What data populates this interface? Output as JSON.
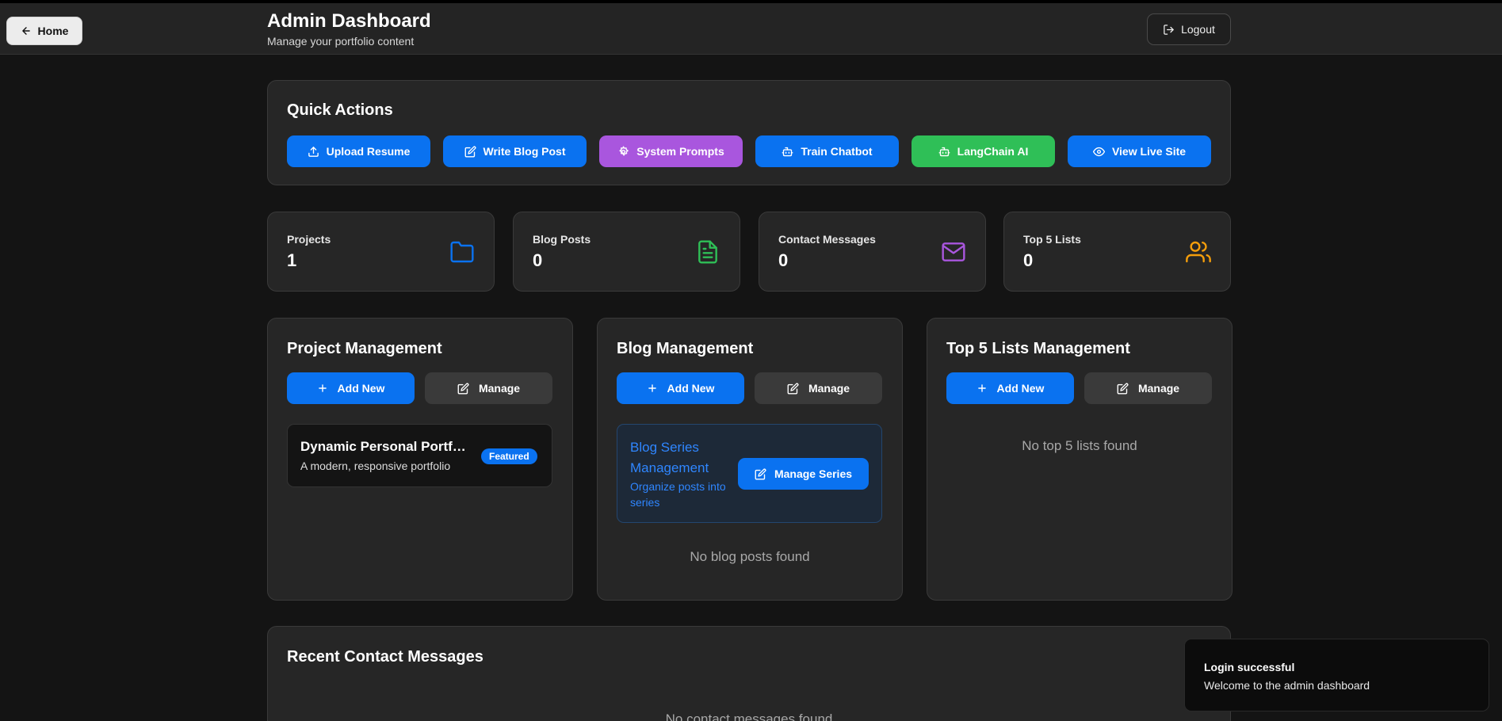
{
  "header": {
    "home_label": "Home",
    "title": "Admin Dashboard",
    "subtitle": "Manage your portfolio content",
    "logout_label": "Logout"
  },
  "quick_actions": {
    "title": "Quick Actions",
    "buttons": [
      {
        "label": "Upload Resume",
        "icon": "upload-icon",
        "color": "#0a72f0"
      },
      {
        "label": "Write Blog Post",
        "icon": "edit-icon",
        "color": "#0a72f0"
      },
      {
        "label": "System Prompts",
        "icon": "gear-icon",
        "color": "#a956de"
      },
      {
        "label": "Train Chatbot",
        "icon": "bot-icon",
        "color": "#0a72f0"
      },
      {
        "label": "LangChain AI",
        "icon": "bot-icon",
        "color": "#2fbf57"
      },
      {
        "label": "View Live Site",
        "icon": "eye-icon",
        "color": "#0a72f0"
      }
    ]
  },
  "stats": [
    {
      "label": "Projects",
      "value": "1",
      "icon": "folder-icon",
      "color": "#0a72f0"
    },
    {
      "label": "Blog Posts",
      "value": "0",
      "icon": "file-text-icon",
      "color": "#2fbf57"
    },
    {
      "label": "Contact Messages",
      "value": "0",
      "icon": "mail-icon",
      "color": "#a956de"
    },
    {
      "label": "Top 5 Lists",
      "value": "0",
      "icon": "users-icon",
      "color": "#f59e0b"
    }
  ],
  "project_mgmt": {
    "title": "Project Management",
    "add_label": "Add New",
    "manage_label": "Manage",
    "project": {
      "name": "Dynamic Personal Portfolio",
      "description": "A modern, responsive portfolio",
      "badge": "Featured"
    }
  },
  "blog_mgmt": {
    "title": "Blog Management",
    "add_label": "Add New",
    "manage_label": "Manage",
    "series_title": "Blog Series Management",
    "series_desc": "Organize posts into series",
    "series_button": "Manage Series",
    "empty": "No blog posts found"
  },
  "lists_mgmt": {
    "title": "Top 5 Lists Management",
    "add_label": "Add New",
    "manage_label": "Manage",
    "empty": "No top 5 lists found"
  },
  "messages": {
    "title": "Recent Contact Messages",
    "empty": "No contact messages found"
  },
  "toast": {
    "title": "Login successful",
    "message": "Welcome to the admin dashboard"
  }
}
